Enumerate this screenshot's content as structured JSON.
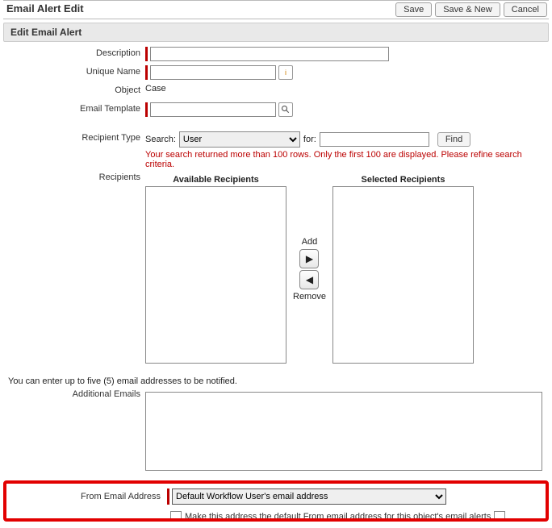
{
  "header": {
    "title": "Email Alert Edit",
    "save": "Save",
    "save_new": "Save & New",
    "cancel": "Cancel"
  },
  "section": {
    "title": "Edit Email Alert"
  },
  "fields": {
    "description_label": "Description",
    "unique_name_label": "Unique Name",
    "object_label": "Object",
    "object_value": "Case",
    "email_template_label": "Email Template",
    "recipient_type_label": "Recipient Type",
    "recipients_label": "Recipients",
    "available_title": "Available Recipients",
    "selected_title": "Selected Recipients",
    "add_label": "Add",
    "remove_label": "Remove",
    "search_label": "Search:",
    "search_type_options": [
      "User"
    ],
    "search_type_selected": "User",
    "for_label": "for:",
    "find_label": "Find",
    "warning": "Your search returned more than 100 rows. Only the first 100 are displayed. Please refine search criteria.",
    "additional_note": "You can enter up to five (5) email addresses to be notified.",
    "additional_emails_label": "Additional Emails",
    "from_label": "From Email Address",
    "from_selected": "Default Workflow User's email address",
    "from_options": [
      "Default Workflow User's email address"
    ],
    "from_default_note": "Make this address the default From email address for this object's email alerts"
  }
}
